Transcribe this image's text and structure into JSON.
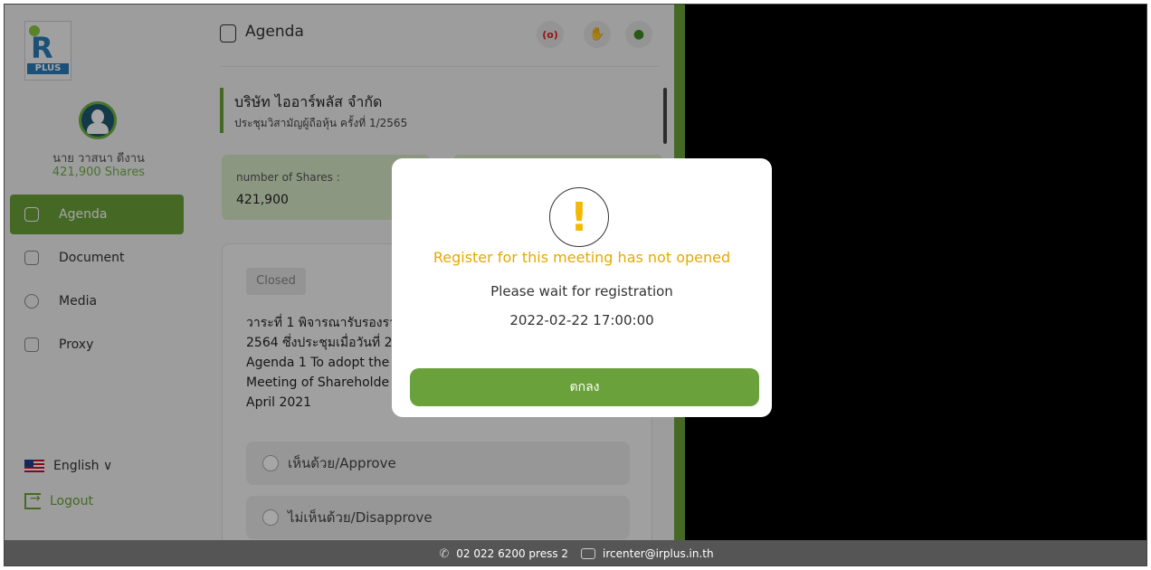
{
  "sidebar": {
    "logo_text": "PLUS",
    "user_name": "นาย วาสนา ดีงาน",
    "user_shares": "421,900 Shares",
    "items": [
      {
        "label": "Agenda"
      },
      {
        "label": "Document"
      },
      {
        "label": "Media"
      },
      {
        "label": "Proxy"
      }
    ],
    "language": "English ∨",
    "logout": "Logout"
  },
  "header": {
    "title": "Agenda",
    "live_label": "(o)"
  },
  "company": {
    "name": "บริษัท ไออาร์พลัส จำกัด",
    "meeting": "ประชุมวิสามัญผู้ถือหุ้น ครั้งที่ 1/2565"
  },
  "shares_card": {
    "label": "number of Shares :",
    "value": "421,900"
  },
  "agenda_item": {
    "status": "Closed",
    "text": "วาระที่ 1 พิจารณารับรองรา\n2564 ซึ่งประชุมเมื่อวันที่ 2\nAgenda 1 To adopt the\nMeeting of Shareholde\nApril 2021",
    "options": [
      {
        "label": "เห็นด้วย/Approve"
      },
      {
        "label": "ไม่เห็นด้วย/Disapprove"
      }
    ]
  },
  "modal": {
    "icon": "!",
    "title": "Register for this meeting has not opened",
    "message": "Please wait for registration",
    "datetime": "2022-02-22 17:00:00",
    "button": "ตกลง"
  },
  "footer": {
    "phone": "02 022 6200 press 2",
    "email": "ircenter@irplus.in.th"
  },
  "colors": {
    "accent": "#6aa13a",
    "warning": "#e6a900",
    "footer_bg": "#555555"
  }
}
